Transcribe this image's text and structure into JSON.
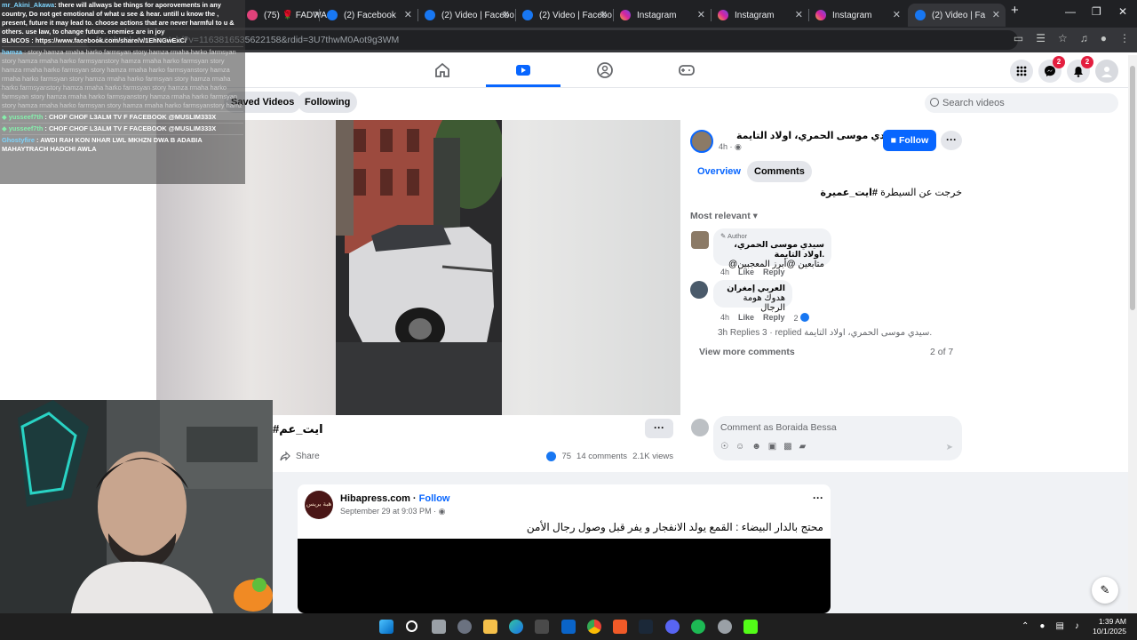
{
  "browser": {
    "tabs": [
      {
        "label": "(75) 🌹 FADWA 💜",
        "color": "#e0427a"
      },
      {
        "label": "(2) Facebook",
        "color": "#1877f2"
      },
      {
        "label": "(2) Video | Facebo",
        "color": "#1877f2"
      },
      {
        "label": "(2) Video | Facebo",
        "color": "#1877f2"
      },
      {
        "label": "Instagram",
        "color": "#d6249f"
      },
      {
        "label": "Instagram",
        "color": "#d6249f"
      },
      {
        "label": "Instagram",
        "color": "#d6249f"
      },
      {
        "label": "(2) Video | Fa",
        "color": "#1877f2"
      }
    ],
    "close_glyph": "✕",
    "new_tab_glyph": "+",
    "url": "facebook.com/watch/?v=1163816535622158&rdid=3U7thwM0Aot9g3WM"
  },
  "fb": {
    "messenger_badge": "2",
    "notifications_badge": "2",
    "tabs": {
      "saved": "Saved Videos",
      "following": "Following"
    },
    "search_placeholder": "Search videos"
  },
  "video_post": {
    "title": "#ايت_عم",
    "more_glyph": "···",
    "share_label": "Share",
    "like_count": "75",
    "comments_count": "14 comments",
    "views": "2.1K views"
  },
  "panel": {
    "page_name": "سيدي موسى الحمري، اولاد التايمة.",
    "page_time": "4h ·",
    "follow_label": "Follow",
    "tabs": {
      "overview": "Overview",
      "comments": "Comments"
    },
    "caption_tag": "#ايت_عميرة",
    "caption_rest": " خرجت عن السيطرة",
    "sort_label": "Most relevant",
    "comments": [
      {
        "badge": "Author",
        "author": "سيدي موسى الحمري، اولاد التايمة.",
        "text": "@متابعين @أبرز المعجبين",
        "time": "4h",
        "like": "Like",
        "reply": "Reply"
      },
      {
        "author": "العربي إمغران",
        "text": "هدوك هومة الرجال",
        "time": "4h",
        "like": "Like",
        "reply": "Reply",
        "reactions": "2"
      }
    ],
    "replies_line": "3h Replies 3 · replied  سيدي موسى الحمري، اولاد التايمة.",
    "view_more": "View more comments",
    "count": "2 of 7",
    "composer_placeholder": "Comment as Boraida Bessa"
  },
  "feed_post": {
    "author": "Hibapress.com",
    "follow": "Follow",
    "date": "September 29 at 9:03 PM ·",
    "avatar_text": "هبة بريس",
    "text": "محتج بالدار البيضاء : القمع يولد الانفجار و يفر قبل وصول رجال الأمن"
  },
  "chat": [
    {
      "user": "mr_Akini_Akawa",
      "user_color": "#7dd3fc",
      "text": ": there will allways be things for aporovements in any country, Do not get emotional of what u see & hear. untill u know the , present, future it may lead to. choose actions that are never harmful to u & others. use law, to change future. enemies are in joy"
    },
    {
      "user": "",
      "user_color": "#7dd3fc",
      "text": "BLNCOS : https://www.facebook.com/share/v/1EhNGwExC/"
    },
    {
      "user": "hamza",
      "user_color": "#7dd3fc",
      "text": " : story hamza rmaha harko farmsyan story hamza rmaha harko farmsyan story hamza rmaha harko farmsyanstory hamza rmaha harko farmsyan story hamza rmaha harko farmsyan story hamza rmaha harko farmsyanstory hamza rmaha harko farmsyan story hamza rmaha harko farmsyan story hamza rmaha harko farmsyanstory hamza rmaha harko farmsyan story hamza rmaha harko farmsyan story hamza rmaha harko farmsyanstory hamza rmaha harko farmsyan story hamza rmaha harko farmsyan story hamza rmaha harko farmsyanstory hamz"
    },
    {
      "user": "yusseef7th",
      "user_color": "#86efac",
      "text": " : CHOF CHOF L3ALM TV F FACEBOOK @MUSLIM333X"
    },
    {
      "user": "yusseef7th",
      "user_color": "#86efac",
      "text": " : CHOF CHOF L3ALM TV F FACEBOOK @MUSLIM333X"
    },
    {
      "user": "Ghostyfire",
      "user_color": "#7dd3fc",
      "text": " : AWDI RAH KON NHAR LWL MKHZN DWA B ADABIA MAHAYTRACH HADCHI AWLA"
    }
  ],
  "taskbar": {
    "time": "1:39 AM",
    "date": "10/1/2025"
  }
}
